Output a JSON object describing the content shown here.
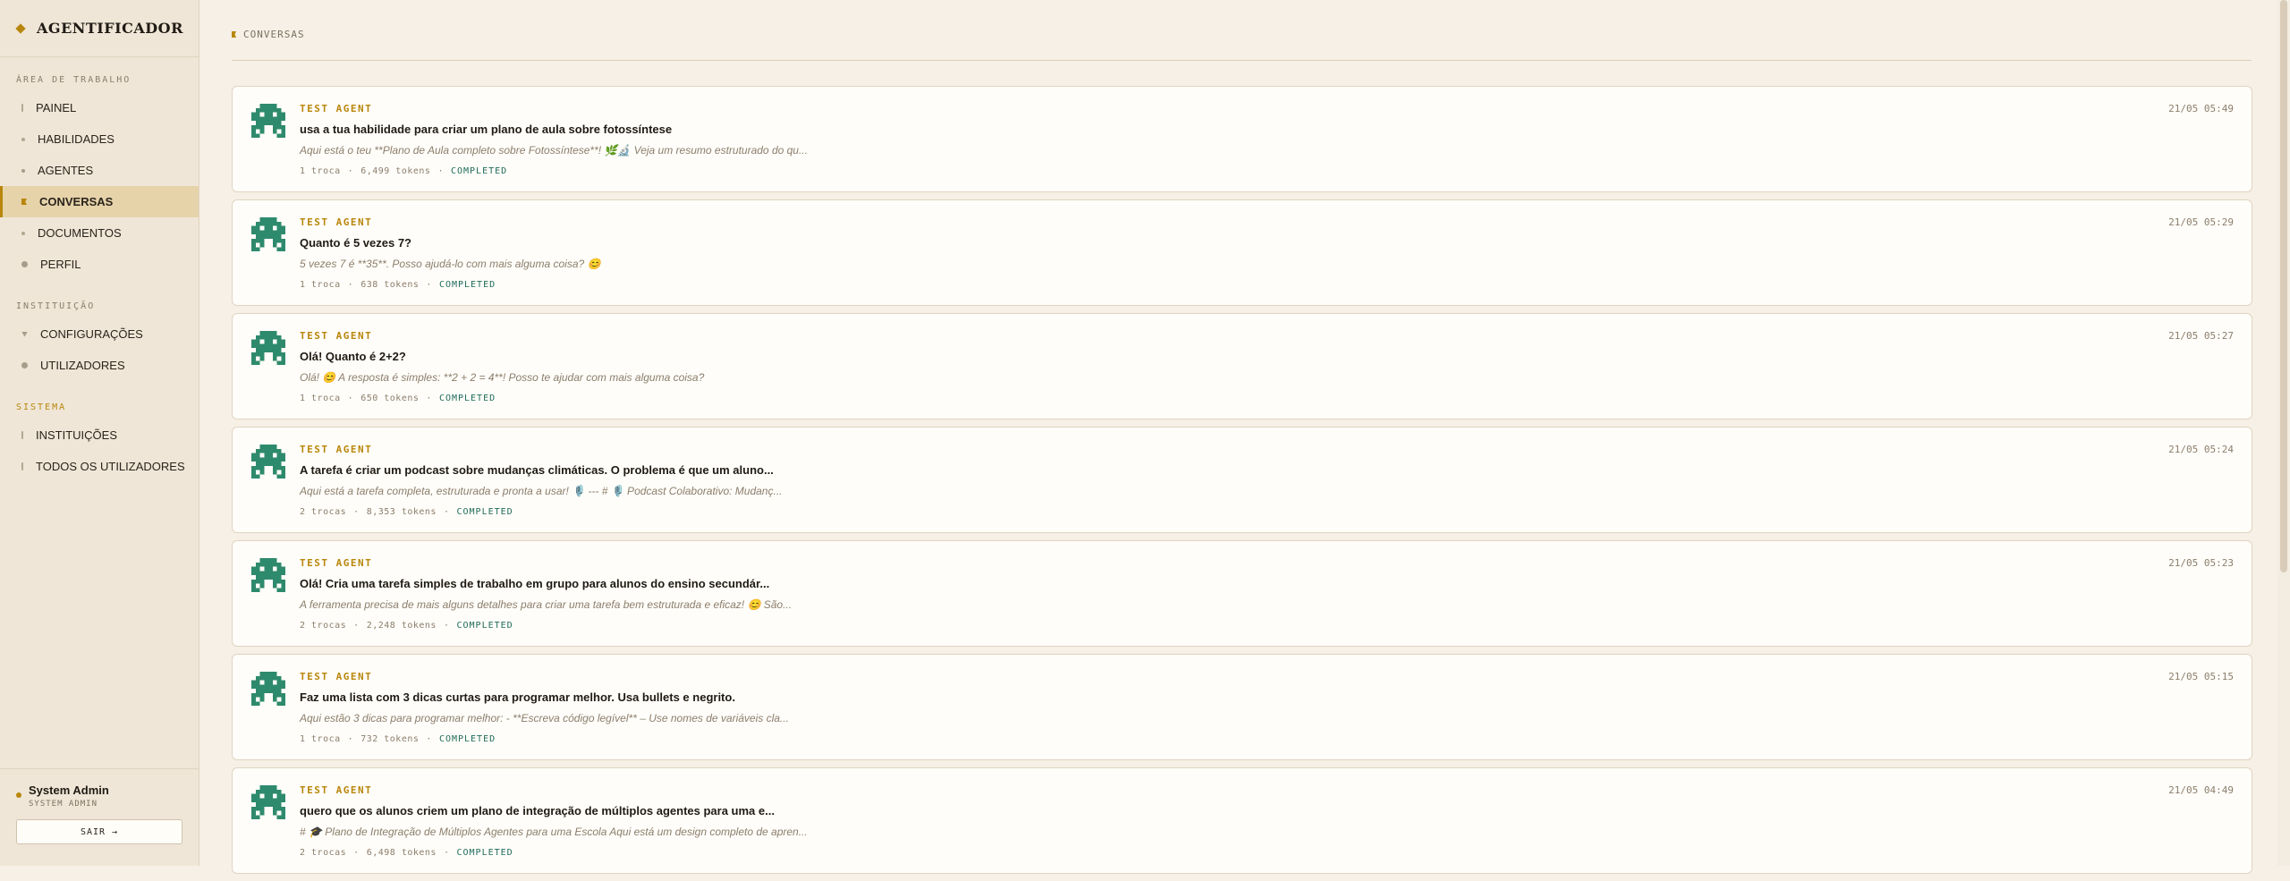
{
  "app": {
    "name": "AGENTIFICADOR"
  },
  "sidebar": {
    "sections": [
      {
        "label": "ÁREA DE TRABALHO",
        "accent": false,
        "items": [
          {
            "label": "PAINEL",
            "icon": "bar-icon",
            "active": false
          },
          {
            "label": "HABILIDADES",
            "icon": "dot-icon",
            "active": false
          },
          {
            "label": "AGENTES",
            "icon": "spark-icon",
            "active": false
          },
          {
            "label": "CONVERSAS",
            "icon": "flag-icon",
            "active": true
          },
          {
            "label": "DOCUMENTOS",
            "icon": "dot-icon",
            "active": false
          },
          {
            "label": "PERFIL",
            "icon": "circle-icon",
            "active": false
          }
        ]
      },
      {
        "label": "INSTITUIÇÃO",
        "accent": false,
        "items": [
          {
            "label": "CONFIGURAÇÕES",
            "icon": "triangle-icon",
            "active": false
          },
          {
            "label": "UTILIZADORES",
            "icon": "circle-icon",
            "active": false
          }
        ]
      },
      {
        "label": "SISTEMA",
        "accent": true,
        "items": [
          {
            "label": "INSTITUIÇÕES",
            "icon": "bar-icon",
            "active": false
          },
          {
            "label": "TODOS OS UTILIZADORES",
            "icon": "bar-icon",
            "active": false
          }
        ]
      }
    ],
    "user": {
      "name": "System Admin",
      "role": "SYSTEM ADMIN"
    },
    "logout_label": "SAIR →"
  },
  "main": {
    "breadcrumb": "CONVERSAS",
    "conversations": [
      {
        "agent": "TEST AGENT",
        "title": "usa a tua habilidade para criar um plano de aula sobre fotossíntese",
        "preview": "Aqui está o teu **Plano de Aula completo sobre Fotossíntese**! 🌿🔬 Veja um resumo estruturado do qu...",
        "exchanges": "1 troca",
        "tokens": "6,499 tokens",
        "status": "COMPLETED",
        "time": "21/05 05:49"
      },
      {
        "agent": "TEST AGENT",
        "title": "Quanto é 5 vezes 7?",
        "preview": "5 vezes 7 é **35**. Posso ajudá-lo com mais alguma coisa? 😊",
        "exchanges": "1 troca",
        "tokens": "638 tokens",
        "status": "COMPLETED",
        "time": "21/05 05:29"
      },
      {
        "agent": "TEST AGENT",
        "title": "Olá! Quanto é 2+2?",
        "preview": "Olá! 😊 A resposta é simples: **2 + 2 = 4**! Posso te ajudar com mais alguma coisa?",
        "exchanges": "1 troca",
        "tokens": "650 tokens",
        "status": "COMPLETED",
        "time": "21/05 05:27"
      },
      {
        "agent": "TEST AGENT",
        "title": "A tarefa é criar um podcast sobre mudanças climáticas. O problema é que um aluno...",
        "preview": "Aqui está a tarefa completa, estruturada e pronta a usar! 🎙️ --- # 🎙️ Podcast Colaborativo: Mudanç...",
        "exchanges": "2 trocas",
        "tokens": "8,353 tokens",
        "status": "COMPLETED",
        "time": "21/05 05:24"
      },
      {
        "agent": "TEST AGENT",
        "title": "Olá! Cria uma tarefa simples de trabalho em grupo para alunos do ensino secundár...",
        "preview": "A ferramenta precisa de mais alguns detalhes para criar uma tarefa bem estruturada e eficaz! 😊 São...",
        "exchanges": "2 trocas",
        "tokens": "2,248 tokens",
        "status": "COMPLETED",
        "time": "21/05 05:23"
      },
      {
        "agent": "TEST AGENT",
        "title": "Faz uma lista com 3 dicas curtas para programar melhor. Usa bullets e negrito.",
        "preview": "Aqui estão 3 dicas para programar melhor: - **Escreva código legível** – Use nomes de variáveis cla...",
        "exchanges": "1 troca",
        "tokens": "732 tokens",
        "status": "COMPLETED",
        "time": "21/05 05:15"
      },
      {
        "agent": "TEST AGENT",
        "title": "quero que os alunos criem um plano de integração de múltiplos agentes para uma e...",
        "preview": "# 🎓 Plano de Integração de Múltiplos Agentes para uma Escola Aqui está um design completo de apren...",
        "exchanges": "2 trocas",
        "tokens": "6,498 tokens",
        "status": "COMPLETED",
        "time": "21/05 04:49"
      }
    ]
  },
  "colors": {
    "accent": "#b8860b",
    "status": "#1f6b5a",
    "avatar": "#2e8a6c",
    "background": "#f6f0e6",
    "sidebar": "#efe6d7"
  }
}
